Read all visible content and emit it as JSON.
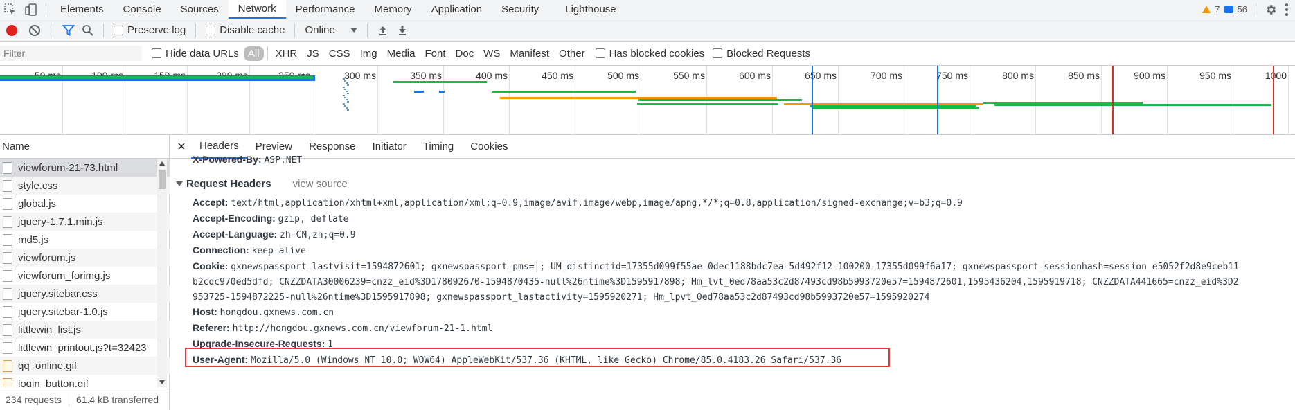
{
  "devtools": {
    "tabs": [
      "Elements",
      "Console",
      "Sources",
      "Network",
      "Performance",
      "Memory",
      "Application",
      "Security",
      "Lighthouse"
    ],
    "active_tab": "Network",
    "warnings_count": "7",
    "messages_count": "56"
  },
  "toolbar": {
    "preserve_log_label": "Preserve log",
    "disable_cache_label": "Disable cache",
    "throttle_value": "Online"
  },
  "filter": {
    "placeholder": "Filter",
    "hide_data_urls_label": "Hide data URLs",
    "types": [
      "All",
      "XHR",
      "JS",
      "CSS",
      "Img",
      "Media",
      "Font",
      "Doc",
      "WS",
      "Manifest",
      "Other"
    ],
    "active_type": "All",
    "has_blocked_cookies_label": "Has blocked cookies",
    "blocked_requests_label": "Blocked Requests"
  },
  "overview": {
    "ticks": [
      "50 ms",
      "100 ms",
      "150 ms",
      "200 ms",
      "250 ms",
      "300 ms",
      "350 ms",
      "400 ms",
      "450 ms",
      "500 ms",
      "550 ms",
      "600 ms",
      "650 ms",
      "700 ms",
      "750 ms",
      "800 ms",
      "850 ms",
      "900 ms",
      "950 ms",
      "1000"
    ],
    "colors": {
      "green": "#1aba49",
      "orange": "#f29900",
      "blue": "#1a73e8",
      "red": "#d93025",
      "dom_line": "#1a73e8",
      "load_line": "#d93025"
    }
  },
  "requests": {
    "header_name": "Name",
    "items": [
      {
        "name": "viewforum-21-73.html",
        "icon": "document-icon"
      },
      {
        "name": "style.css",
        "icon": "document-icon"
      },
      {
        "name": "global.js",
        "icon": "document-icon"
      },
      {
        "name": "jquery-1.7.1.min.js",
        "icon": "document-icon"
      },
      {
        "name": "md5.js",
        "icon": "document-icon"
      },
      {
        "name": "viewforum.js",
        "icon": "document-icon"
      },
      {
        "name": "viewforum_forimg.js",
        "icon": "document-icon"
      },
      {
        "name": "jquery.sitebar.css",
        "icon": "document-icon"
      },
      {
        "name": "jquery.sitebar-1.0.js",
        "icon": "document-icon"
      },
      {
        "name": "littlewin_list.js",
        "icon": "document-icon"
      },
      {
        "name": "littlewin_printout.js?t=32423",
        "icon": "document-icon"
      },
      {
        "name": "qq_online.gif",
        "icon": "image-icon"
      },
      {
        "name": "login_button.gif",
        "icon": "image-icon"
      }
    ],
    "requests_count": "234 requests",
    "transferred": "61.4 kB transferred"
  },
  "details": {
    "tabs": [
      "Headers",
      "Preview",
      "Response",
      "Initiator",
      "Timing",
      "Cookies"
    ],
    "active_tab": "Headers",
    "partial_top_header": {
      "name": "X-Powered-By:",
      "value": "ASP.NET"
    },
    "section_title": "Request Headers",
    "view_source": "view source",
    "headers": [
      {
        "name": "Accept:",
        "value": "text/html,application/xhtml+xml,application/xml;q=0.9,image/avif,image/webp,image/apng,*/*;q=0.8,application/signed-exchange;v=b3;q=0.9"
      },
      {
        "name": "Accept-Encoding:",
        "value": "gzip, deflate"
      },
      {
        "name": "Accept-Language:",
        "value": "zh-CN,zh;q=0.9"
      },
      {
        "name": "Connection:",
        "value": "keep-alive"
      },
      {
        "name": "Cookie:",
        "value": "gxnewspassport_lastvisit=1594872601; gxnewspassport_pms=|; UM_distinctid=17355d099f55ae-0dec1188bdc7ea-5d492f12-100200-17355d099f6a17; gxnewspassport_sessionhash=session_e5052f2d8e9ceb11",
        "cont1": "b2cdc970ed5dfd; CNZZDATA30006239=cnzz_eid%3D178092670-1594870435-null%26ntime%3D1595917898; Hm_lvt_0ed78aa53c2d87493cd98b5993720e57=1594872601,1595436204,1595919718; CNZZDATA441665=cnzz_eid%3D2",
        "cont2": "953725-1594872225-null%26ntime%3D1595917898; gxnewspassport_lastactivity=1595920271; Hm_lpvt_0ed78aa53c2d87493cd98b5993720e57=1595920274"
      },
      {
        "name": "Host:",
        "value": "hongdou.gxnews.com.cn"
      },
      {
        "name": "Referer:",
        "value": "http://hongdou.gxnews.com.cn/viewforum-21-1.html"
      },
      {
        "name": "Upgrade-Insecure-Requests:",
        "value": "1"
      },
      {
        "name": "User-Agent:",
        "value": "Mozilla/5.0 (Windows NT 10.0; WOW64) AppleWebKit/537.36 (KHTML, like Gecko) Chrome/85.0.4183.26 Safari/537.36"
      }
    ]
  }
}
